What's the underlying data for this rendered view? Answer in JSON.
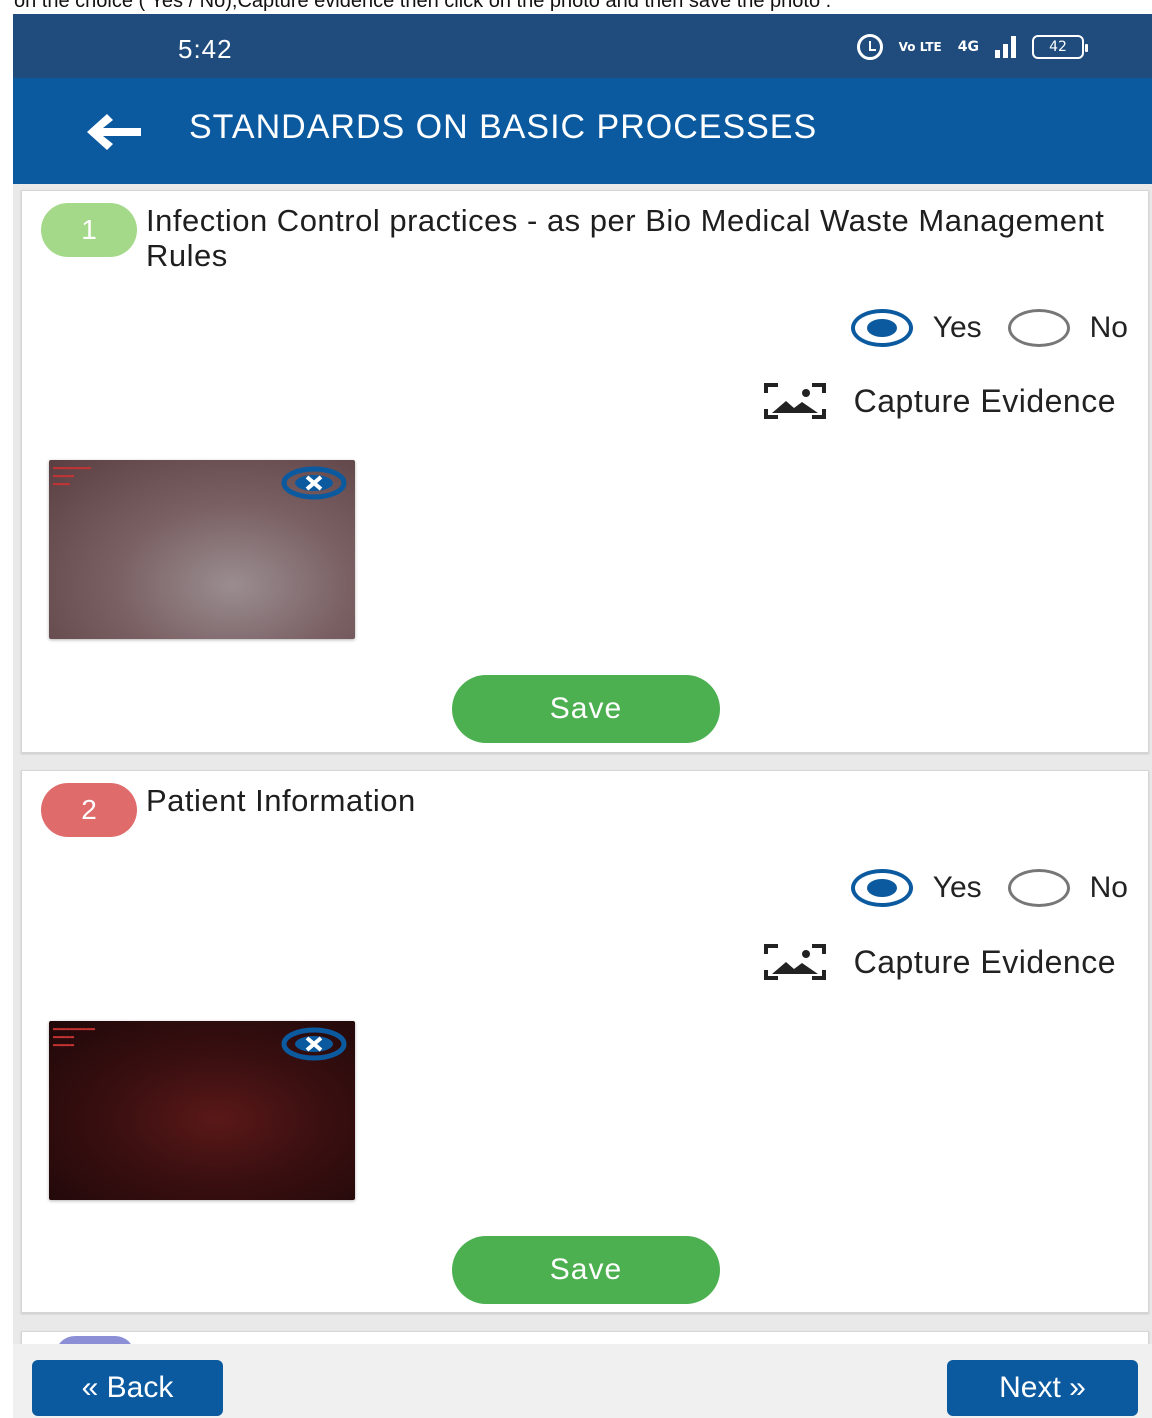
{
  "caption": "on the choice ( Yes / No),Capture evidence then click on the photo and then save the photo .",
  "status_bar": {
    "time": "5:42",
    "volte": "Vo LTE",
    "network": "4G",
    "battery": "42"
  },
  "app_bar": {
    "title": "STANDARDS ON BASIC PROCESSES",
    "back_icon": "arrow-left-icon"
  },
  "colors": {
    "app_bar": "#0b5aa0",
    "status_bar": "#1f4b7d",
    "save_button": "#4caf50",
    "badge_1": "#a5d98a",
    "badge_2": "#e06b6b",
    "badge_3": "#8c8fd6"
  },
  "questions": [
    {
      "number": "1",
      "title": "Infection Control practices - as per Bio Medical Waste Management Rules",
      "yes_label": "Yes",
      "no_label": "No",
      "selected": "Yes",
      "capture_label": "Capture Evidence",
      "save_label": "Save"
    },
    {
      "number": "2",
      "title": "Patient Information",
      "yes_label": "Yes",
      "no_label": "No",
      "selected": "Yes",
      "capture_label": "Capture Evidence",
      "save_label": "Save"
    }
  ],
  "footer": {
    "back_label": "« Back",
    "next_label": "Next »"
  }
}
